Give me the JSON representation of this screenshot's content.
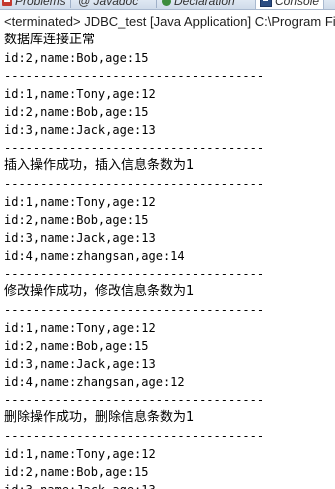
{
  "tabs": [
    {
      "label": "Problems",
      "icon": "problems-icon"
    },
    {
      "label": "@ Javadoc",
      "icon": "javadoc-icon"
    },
    {
      "label": "Declaration",
      "icon": "declaration-icon"
    },
    {
      "label": "Console",
      "icon": "console-icon",
      "active": true
    }
  ],
  "status": "<terminated> JDBC_test [Java Application] C:\\Program Fil",
  "console_lines": [
    "数据库连接正常",
    "id:2,name:Bob,age:15",
    "------------------------------------",
    "id:1,name:Tony,age:12",
    "id:2,name:Bob,age:15",
    "id:3,name:Jack,age:13",
    "------------------------------------",
    "插入操作成功，插入信息条数为1",
    "------------------------------------",
    "id:1,name:Tony,age:12",
    "id:2,name:Bob,age:15",
    "id:3,name:Jack,age:13",
    "id:4,name:zhangsan,age:14",
    "------------------------------------",
    "修改操作成功，修改信息条数为1",
    "------------------------------------",
    "id:1,name:Tony,age:12",
    "id:2,name:Bob,age:15",
    "id:3,name:Jack,age:13",
    "id:4,name:zhangsan,age:12",
    "------------------------------------",
    "删除操作成功，删除信息条数为1",
    "------------------------------------",
    "id:1,name:Tony,age:12",
    "id:2,name:Bob,age:15",
    "id:3,name:Jack,age:13"
  ]
}
